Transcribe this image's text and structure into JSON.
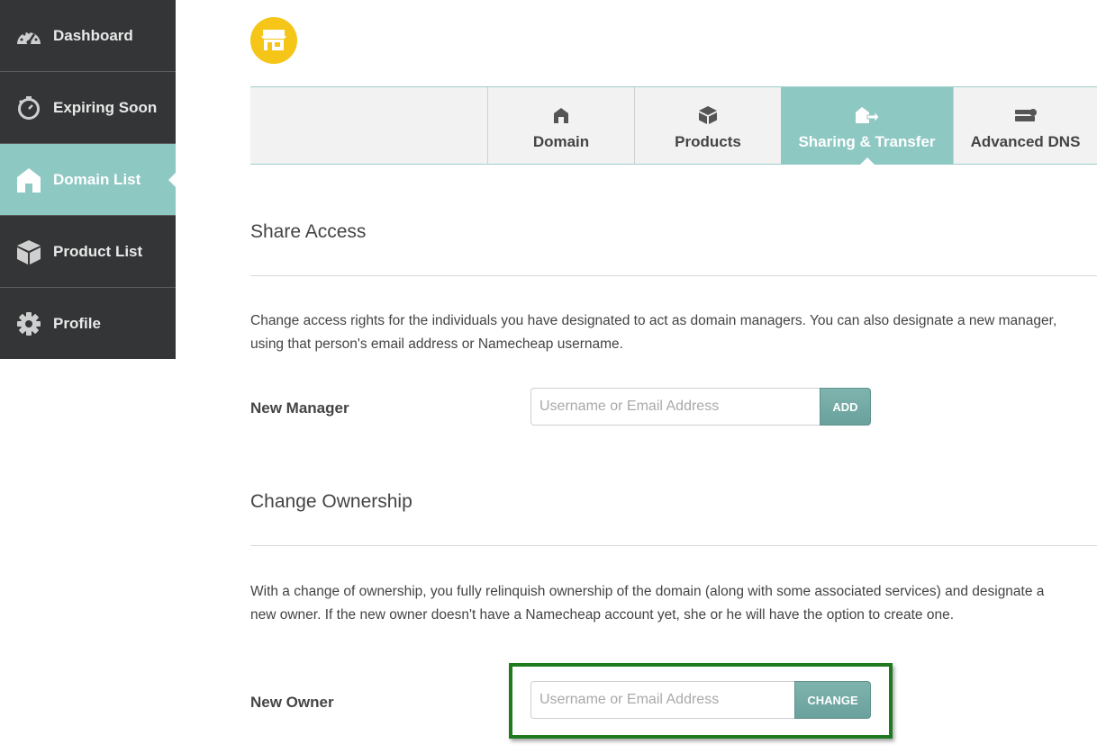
{
  "sidebar": {
    "items": [
      {
        "label": "Dashboard",
        "icon": "speedometer-icon"
      },
      {
        "label": "Expiring Soon",
        "icon": "stopwatch-icon"
      },
      {
        "label": "Domain List",
        "icon": "home-icon",
        "active": true
      },
      {
        "label": "Product List",
        "icon": "box-icon"
      },
      {
        "label": "Profile",
        "icon": "gear-icon"
      }
    ]
  },
  "header": {
    "logo_icon": "storefront-icon",
    "logo_color": "#f5c518"
  },
  "tabs": [
    {
      "label": "Domain",
      "icon": "home-icon"
    },
    {
      "label": "Products",
      "icon": "box-icon"
    },
    {
      "label": "Sharing & Transfer",
      "icon": "share-transfer-icon",
      "active": true
    },
    {
      "label": "Advanced DNS",
      "icon": "server-icon"
    }
  ],
  "share_access": {
    "title": "Share Access",
    "description": "Change access rights for the individuals you have designated to act as domain managers. You can also designate a new manager, using that person's email address or Namecheap username.",
    "field_label": "New Manager",
    "placeholder": "Username or Email Address",
    "button": "ADD"
  },
  "change_ownership": {
    "title": "Change Ownership",
    "description": "With a change of ownership, you fully relinquish ownership of the domain (along with some associated services) and designate a new owner. If the new owner doesn't have a Namecheap account yet, she or he will have the option to create one.",
    "field_label": "New Owner",
    "placeholder": "Username or Email Address",
    "button": "CHANGE"
  },
  "colors": {
    "sidebar_bg": "#333536",
    "accent": "#8ec8c3",
    "button": "#6aa19c",
    "highlight": "#1f7a1f"
  }
}
